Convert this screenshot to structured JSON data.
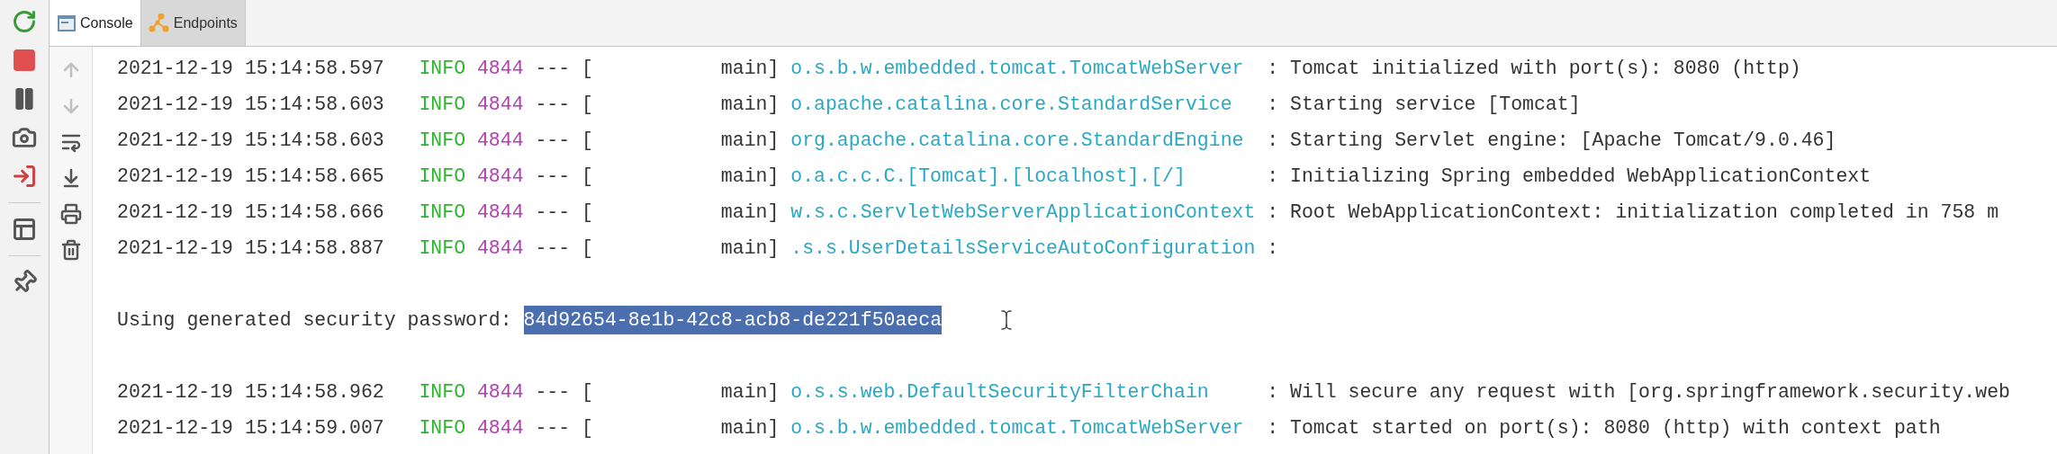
{
  "tabs": [
    {
      "label": "Console",
      "selected": true
    },
    {
      "label": "Endpoints",
      "selected": false
    }
  ],
  "console_toolbar": [
    {
      "disabled": true
    },
    {
      "disabled": true
    },
    {
      "disabled": false
    },
    {
      "disabled": false
    },
    {
      "disabled": false
    },
    {
      "disabled": false
    }
  ],
  "lines": [
    {
      "kind": "log",
      "timestamp": "2021-12-19 15:14:58.597",
      "level": "INFO",
      "pid": "4844",
      "separator": "--- [",
      "thread": "main]",
      "logger": "o.s.b.w.embedded.tomcat.TomcatWebServer",
      "message": ": Tomcat initialized with port(s): 8080 (http)"
    },
    {
      "kind": "log",
      "timestamp": "2021-12-19 15:14:58.603",
      "level": "INFO",
      "pid": "4844",
      "separator": "--- [",
      "thread": "main]",
      "logger": "o.apache.catalina.core.StandardService",
      "message": ": Starting service [Tomcat]"
    },
    {
      "kind": "log",
      "timestamp": "2021-12-19 15:14:58.603",
      "level": "INFO",
      "pid": "4844",
      "separator": "--- [",
      "thread": "main]",
      "logger": "org.apache.catalina.core.StandardEngine",
      "message": ": Starting Servlet engine: [Apache Tomcat/9.0.46]"
    },
    {
      "kind": "log",
      "timestamp": "2021-12-19 15:14:58.665",
      "level": "INFO",
      "pid": "4844",
      "separator": "--- [",
      "thread": "main]",
      "logger": "o.a.c.c.C.[Tomcat].[localhost].[/]",
      "message": ": Initializing Spring embedded WebApplicationContext"
    },
    {
      "kind": "log",
      "timestamp": "2021-12-19 15:14:58.666",
      "level": "INFO",
      "pid": "4844",
      "separator": "--- [",
      "thread": "main]",
      "logger": "w.s.c.ServletWebServerApplicationContext",
      "message": ": Root WebApplicationContext: initialization completed in 758 m"
    },
    {
      "kind": "log",
      "timestamp": "2021-12-19 15:14:58.887",
      "level": "INFO",
      "pid": "4844",
      "separator": "--- [",
      "thread": "main]",
      "logger": ".s.s.UserDetailsServiceAutoConfiguration",
      "message": ":"
    },
    {
      "kind": "blank"
    },
    {
      "kind": "plain",
      "text": "Using generated security password:",
      "value": "84d92654-8e1b-42c8-acb8-de221f50aeca",
      "selected": true
    },
    {
      "kind": "blank"
    },
    {
      "kind": "log",
      "timestamp": "2021-12-19 15:14:58.962",
      "level": "INFO",
      "pid": "4844",
      "separator": "--- [",
      "thread": "main]",
      "logger": "o.s.s.web.DefaultSecurityFilterChain",
      "message": ": Will secure any request with [org.springframework.security.web"
    },
    {
      "kind": "log",
      "timestamp": "2021-12-19 15:14:59.007",
      "level": "INFO",
      "pid": "4844",
      "separator": "--- [",
      "thread": "main]",
      "logger": "o.s.b.w.embedded.tomcat.TomcatWebServer",
      "message": ": Tomcat started on port(s): 8080 (http) with context path"
    }
  ]
}
